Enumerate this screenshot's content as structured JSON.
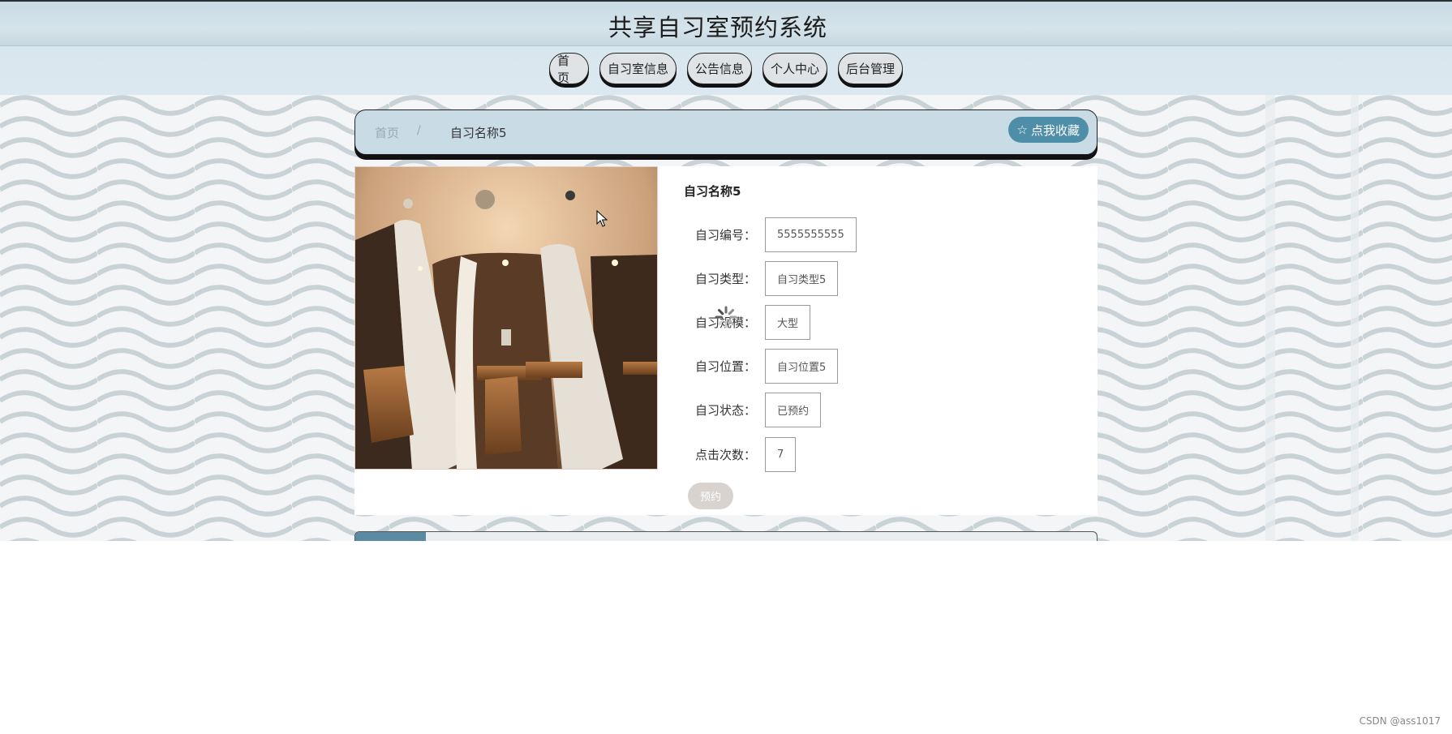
{
  "header": {
    "title": "共享自习室预约系统"
  },
  "nav": {
    "items": [
      "首页",
      "自习室信息",
      "公告信息",
      "个人中心",
      "后台管理"
    ]
  },
  "breadcrumb": {
    "home": "首页",
    "separator": "/",
    "current": "自习名称5"
  },
  "favorite": {
    "label": "点我收藏",
    "icon": "star-outline-icon"
  },
  "room": {
    "name": "自习名称5",
    "fields": [
      {
        "label": "自习编号：",
        "value": "5555555555"
      },
      {
        "label": "自习类型：",
        "value": "自习类型5"
      },
      {
        "label": "自习规模：",
        "value": "大型"
      },
      {
        "label": "自习位置：",
        "value": "自习位置5"
      },
      {
        "label": "自习状态：",
        "value": "已预约"
      },
      {
        "label": "点击次数：",
        "value": "7"
      }
    ],
    "reserve_label": "预约"
  },
  "watermark": "CSDN @ass1017",
  "colors": {
    "accent": "#4f8ea8",
    "header_bg": "#c9dbe4",
    "tab_active": "#5a8ba3"
  }
}
